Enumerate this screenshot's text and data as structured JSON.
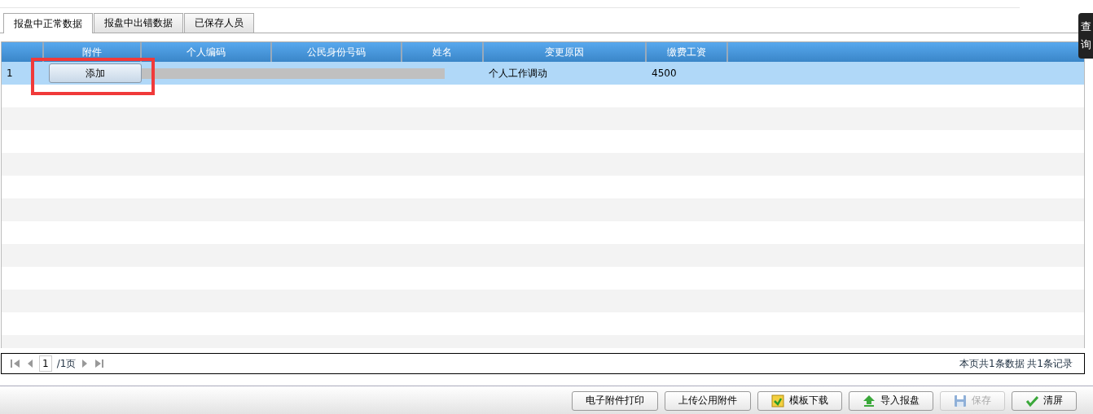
{
  "tabs": [
    {
      "label": "报盘中正常数据",
      "selected": true
    },
    {
      "label": "报盘中出错数据",
      "selected": false
    },
    {
      "label": "已保存人员",
      "selected": false
    }
  ],
  "side_tab": {
    "label": "查询"
  },
  "table": {
    "columns": [
      {
        "label": "附件"
      },
      {
        "label": "个人编码"
      },
      {
        "label": "公民身份号码"
      },
      {
        "label": "姓名"
      },
      {
        "label": "变更原因"
      },
      {
        "label": "缴费工资"
      }
    ],
    "rows": [
      {
        "number": "1",
        "attach_button": "添加",
        "redacted": true,
        "reason": "个人工作调动",
        "wage": "4500",
        "selected": true
      }
    ]
  },
  "pager": {
    "page": "1",
    "total_pages": "/1页",
    "summary": "本页共1条数据 共1条记录"
  },
  "buttons": [
    {
      "label": "电子附件打印",
      "kind": "plain",
      "disabled": false
    },
    {
      "label": "上传公用附件",
      "kind": "plain",
      "disabled": false
    },
    {
      "label": "模板下载",
      "kind": "download",
      "disabled": false
    },
    {
      "label": "导入报盘",
      "kind": "import",
      "disabled": false
    },
    {
      "label": "保存",
      "kind": "save",
      "disabled": true
    },
    {
      "label": "清屏",
      "kind": "clear",
      "disabled": false
    }
  ],
  "annotation": {
    "highlight": true
  }
}
